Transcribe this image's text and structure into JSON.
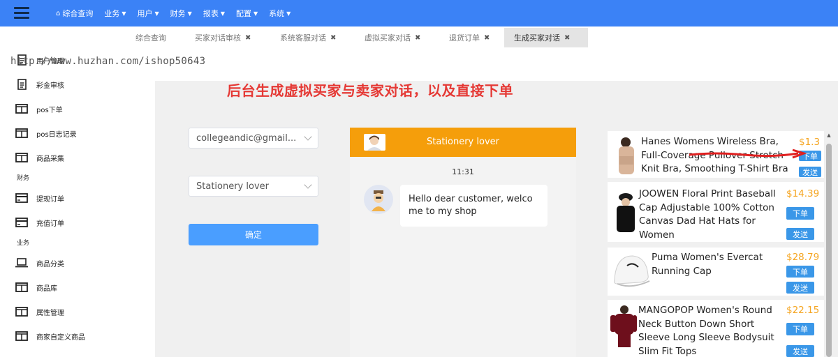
{
  "topnav": {
    "items": [
      {
        "label": "综合查询",
        "icon": "home-icon"
      },
      {
        "label": "业务"
      },
      {
        "label": "用户"
      },
      {
        "label": "财务"
      },
      {
        "label": "报表"
      },
      {
        "label": "配置"
      },
      {
        "label": "系统"
      }
    ]
  },
  "watermark": "http://www.huzhan.com/ishop50643",
  "sidebar": {
    "items": [
      {
        "label": "用户管理",
        "icon": "document-icon"
      },
      {
        "label": "彩金审核",
        "icon": "document-icon"
      },
      {
        "label": "pos下单",
        "icon": "columns-icon"
      },
      {
        "label": "pos日志记录",
        "icon": "columns-icon"
      },
      {
        "label": "商品采集",
        "icon": "columns-icon"
      },
      {
        "label": "提现订单",
        "icon": "card-icon"
      },
      {
        "label": "充值订单",
        "icon": "card-icon"
      },
      {
        "label": "商品分类",
        "icon": "laptop-icon"
      },
      {
        "label": "商品库",
        "icon": "columns-icon"
      },
      {
        "label": "属性管理",
        "icon": "columns-icon"
      },
      {
        "label": "商家自定义商品",
        "icon": "columns-icon"
      }
    ],
    "sections": [
      "财务",
      "业务"
    ]
  },
  "tabs": [
    {
      "label": "综合查询",
      "closable": false
    },
    {
      "label": "买家对话审核",
      "closable": true
    },
    {
      "label": "系统客服对话",
      "closable": true
    },
    {
      "label": "虚拟买家对话",
      "closable": true
    },
    {
      "label": "退货订单",
      "closable": true
    },
    {
      "label": "生成买家对话",
      "closable": true,
      "active": true
    }
  ],
  "close_glyph": "✖",
  "headline": "后台生成虚拟买家与卖家对话，以及直接下单",
  "form": {
    "seller_select": "collegeandic@gmail...",
    "buyer_select": "Stationery lover",
    "confirm_label": "确定"
  },
  "chat": {
    "title": "Stationery lover",
    "time": "11:31",
    "message": "Hello dear customer, welcome to my shop"
  },
  "products": [
    {
      "lines": [
        "Hanes Womens Wireless Bra,",
        "Full-Coverage Pullover Stretch",
        "Knit Bra, Smoothing T-Shirt Bra"
      ],
      "price": "$1.3",
      "order_label": "下单",
      "send_label": "发送"
    },
    {
      "lines": [
        "JOOWEN Floral Print Baseball",
        "Cap Adjustable 100% Cotton",
        "Canvas Dad Hat Hats for",
        "Women"
      ],
      "price": "$14.39",
      "order_label": "下单",
      "send_label": "发送"
    },
    {
      "lines": [
        "Puma Women's Evercat",
        "Running Cap"
      ],
      "price": "$28.79",
      "order_label": "下单",
      "send_label": "发送"
    },
    {
      "lines": [
        "MANGOPOP Women's Round",
        "Neck Button Down Short",
        "Sleeve Long Sleeve Bodysuit",
        "Slim Fit Tops"
      ],
      "price": "$22.15",
      "order_label": "下单",
      "send_label": "发送"
    }
  ],
  "colors": {
    "topbar": "#3b82f6",
    "headline": "#e53935",
    "chat_header": "#f59e0b",
    "price": "#f5a623",
    "button": "#3a97e8",
    "annotation": "#e02020"
  }
}
